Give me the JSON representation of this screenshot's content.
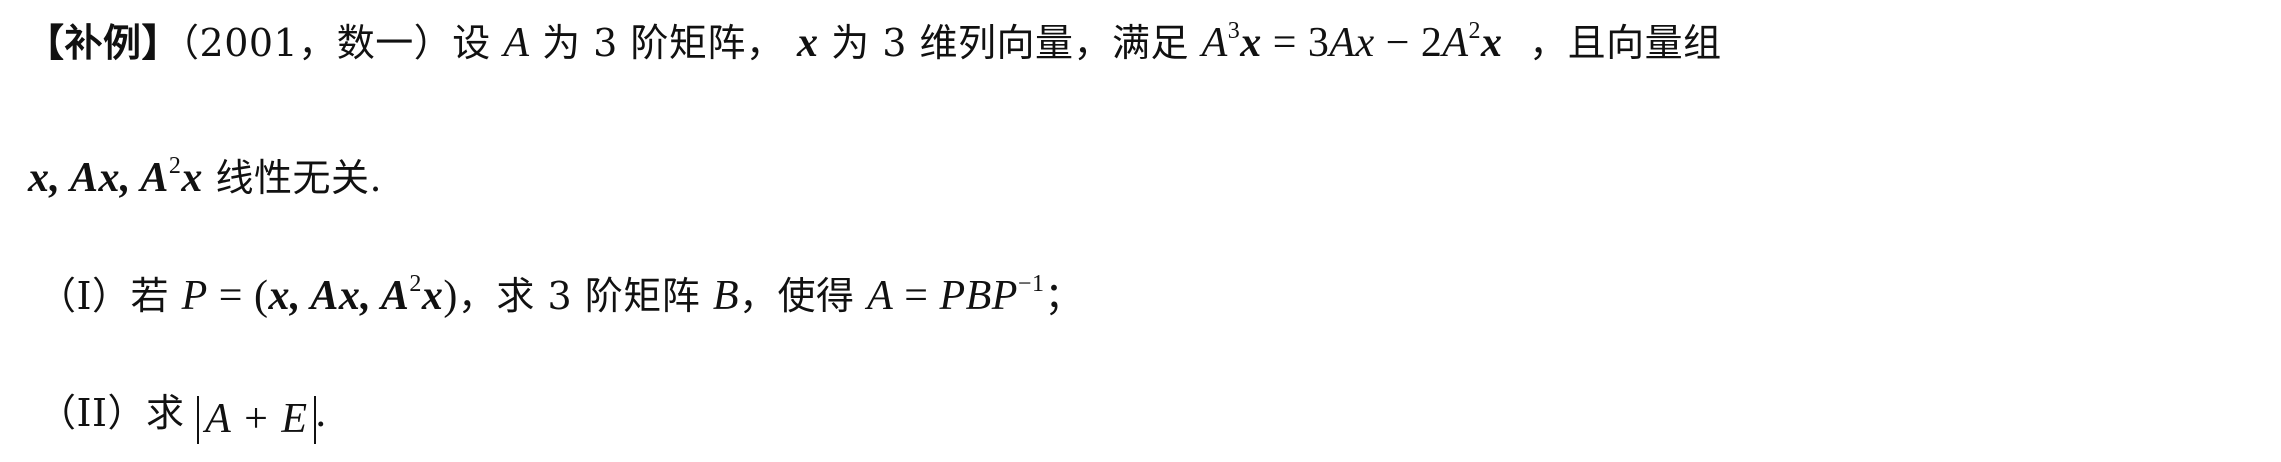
{
  "problem": {
    "tag": "【补例】",
    "source": "（2001，数一）",
    "stem_part1": "设",
    "A": "A",
    "stem_part2": "为 3 阶矩阵，",
    "x": "x",
    "stem_part3": "为 3 维列向量，满足",
    "equation_lhs_base": "A",
    "equation_lhs_exp": "3",
    "equation_lhs_var": "x",
    "equation_mid": " = 3",
    "equation_Ax": "Ax",
    "equation_minus": " − 2",
    "equation_rhs_base": "A",
    "equation_rhs_exp": "2",
    "equation_rhs_var": "x",
    "stem_part4": "，且向量组",
    "line2_vectors": "x, Ax, A",
    "line2_exp": "2",
    "line2_x": "x",
    "line2_text": "线性无关."
  },
  "part1": {
    "label": "（I）",
    "text1": "若",
    "P": "P",
    "eq": " = (",
    "vecs": "x, Ax, A",
    "exp": "2",
    "x": "x",
    "close": ")",
    "text2": "，求 3 阶矩阵",
    "B": "B",
    "text3": "，使得",
    "A": "A",
    "eq2": " = ",
    "PBP": "PBP",
    "inv_exp": "−1",
    "end": "；"
  },
  "part2": {
    "label": "（II）",
    "text": "求",
    "abs_content": "A + E",
    "end": "."
  }
}
